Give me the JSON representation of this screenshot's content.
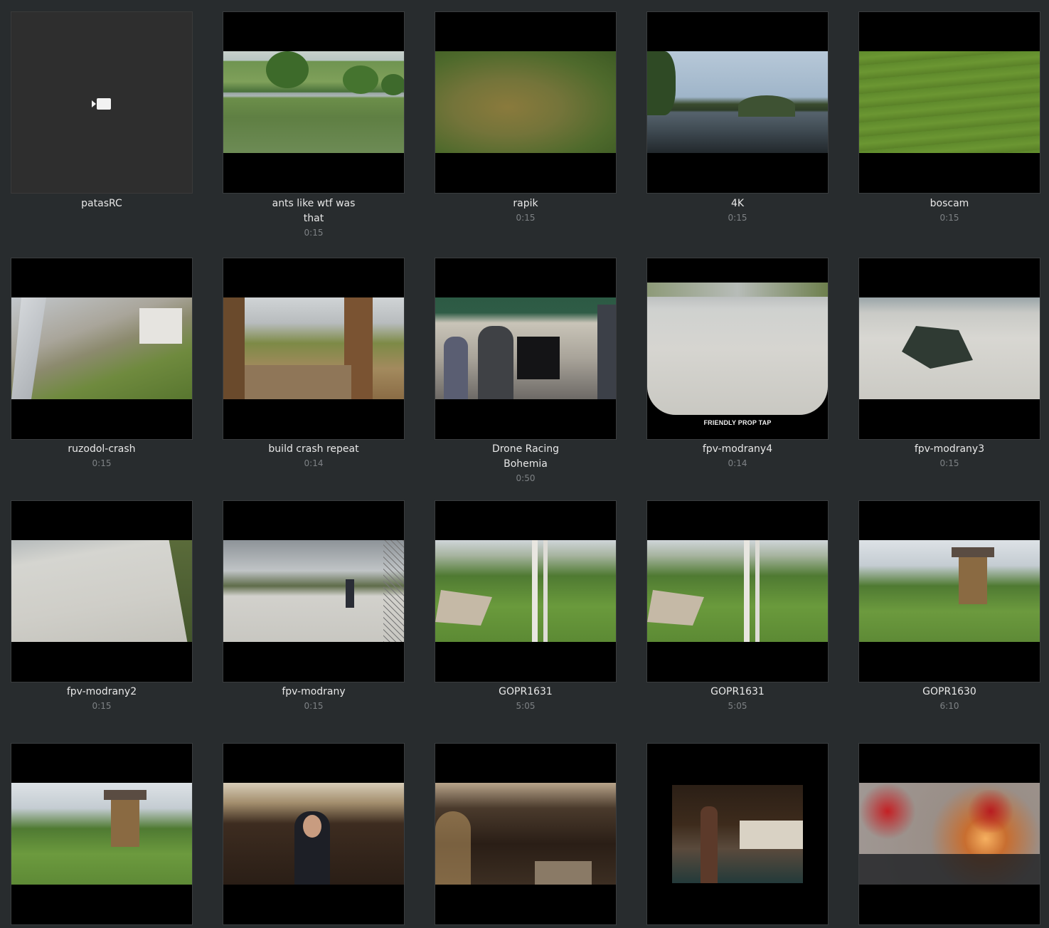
{
  "videos": [
    {
      "title": "patasRC",
      "duration": "",
      "icon": "video-camera-icon"
    },
    {
      "title": "ants like wtf was that",
      "duration": "0:15"
    },
    {
      "title": "rapik",
      "duration": "0:15"
    },
    {
      "title": "4K",
      "duration": "0:15"
    },
    {
      "title": "boscam",
      "duration": "0:15"
    },
    {
      "title": "ruzodol-crash",
      "duration": "0:15"
    },
    {
      "title": "build crash repeat",
      "duration": "0:14"
    },
    {
      "title": "Drone Racing Bohemia",
      "duration": "0:50"
    },
    {
      "title": "fpv-modrany4",
      "duration": "0:14",
      "overlay_text": "FRIENDLY PROP TAP"
    },
    {
      "title": "fpv-modrany3",
      "duration": "0:15"
    },
    {
      "title": "fpv-modrany2",
      "duration": "0:15"
    },
    {
      "title": "fpv-modrany",
      "duration": "0:15"
    },
    {
      "title": "GOPR1631",
      "duration": "5:05"
    },
    {
      "title": "GOPR1631",
      "duration": "5:05"
    },
    {
      "title": "GOPR1630",
      "duration": "6:10"
    },
    {
      "title": "",
      "duration": ""
    },
    {
      "title": "",
      "duration": ""
    },
    {
      "title": "",
      "duration": ""
    },
    {
      "title": "",
      "duration": ""
    },
    {
      "title": "",
      "duration": ""
    }
  ]
}
